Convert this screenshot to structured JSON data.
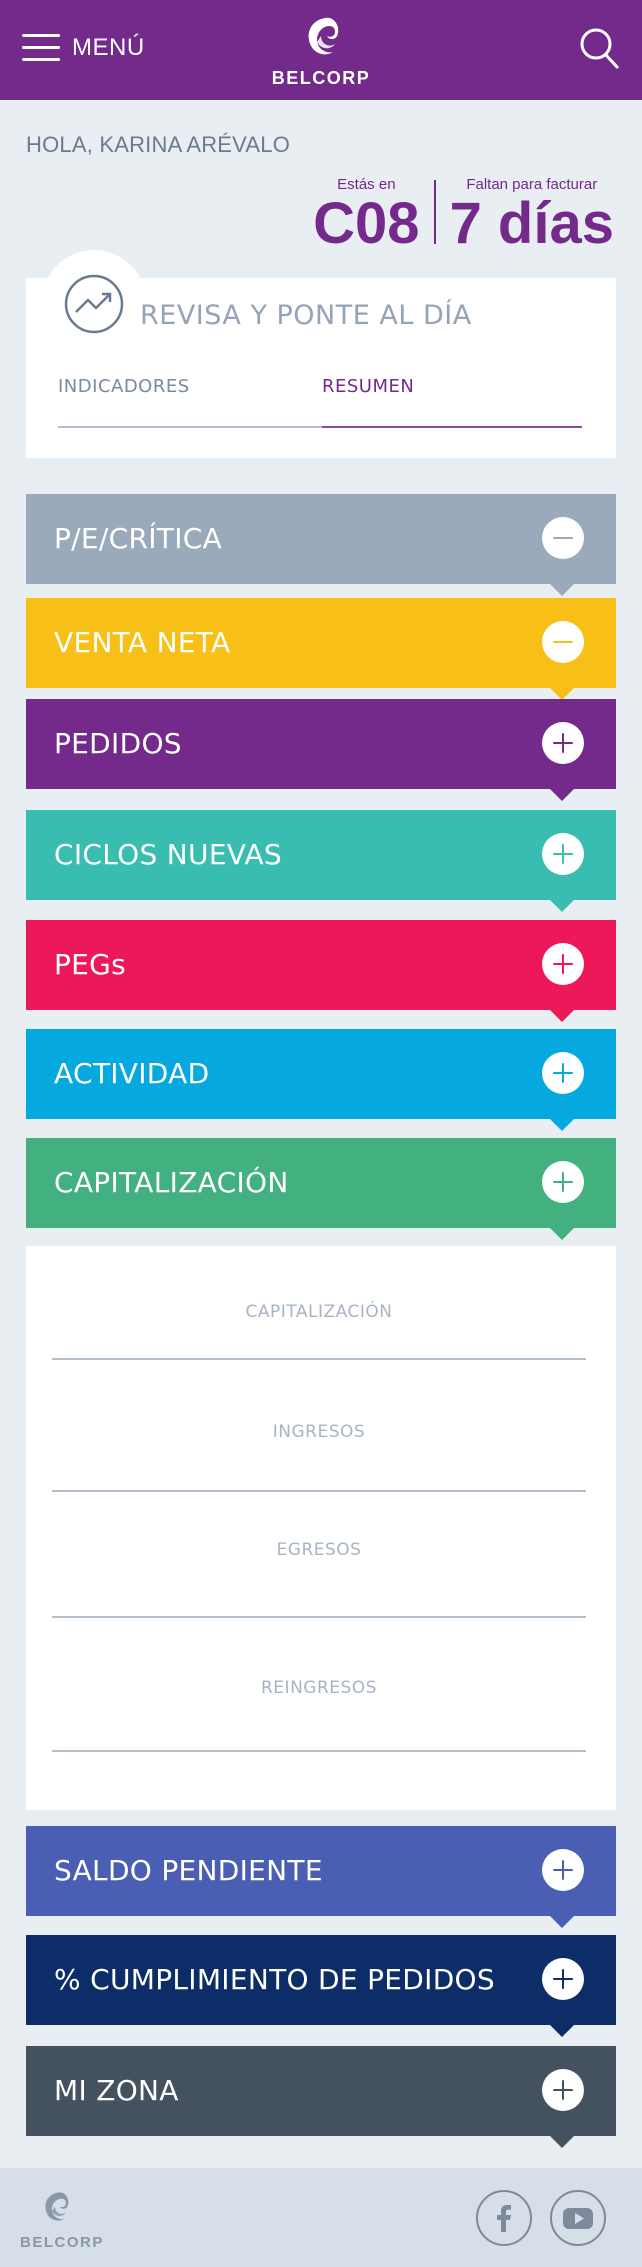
{
  "header": {
    "menu_label": "MENÚ",
    "brand": "BELCORP",
    "background": "#742a8b"
  },
  "greeting": "HOLA, KARINA ARÉVALO",
  "cycle": {
    "current_label": "Estás en",
    "current_value": "C08",
    "remaining_label": "Faltan para facturar",
    "remaining_value": "7 días"
  },
  "card": {
    "title": "REVISA Y PONTE AL DÍA",
    "icon": "trend-chart-icon",
    "tabs": [
      {
        "label": "INDICADORES",
        "active": false
      },
      {
        "label": "RESUMEN",
        "active": true
      }
    ]
  },
  "sections": [
    {
      "label": "P/E/CRÍTICA",
      "color": "#9aaabb",
      "state": "collapse"
    },
    {
      "label": "VENTA NETA",
      "color": "#f8bf17",
      "state": "collapse"
    },
    {
      "label": "PEDIDOS",
      "color": "#742a8b",
      "state": "expand"
    },
    {
      "label": "CICLOS NUEVAS",
      "color": "#3abdb1",
      "state": "expand"
    },
    {
      "label": "PEGs",
      "color": "#ec1859",
      "state": "expand"
    },
    {
      "label": "ACTIVIDAD",
      "color": "#05a9e0",
      "state": "expand"
    },
    {
      "label": "CAPITALIZACIÓN",
      "color": "#42b07f",
      "state": "expand"
    },
    {
      "label": "SALDO PENDIENTE",
      "color": "#4a5fb4",
      "state": "expand"
    },
    {
      "label": "% CUMPLIMIENTO DE PEDIDOS",
      "color": "#0d2d69",
      "state": "expand"
    },
    {
      "label": "MI ZONA",
      "color": "#44515f",
      "state": "expand"
    }
  ],
  "capitalizacion_panel": {
    "metrics": [
      "CAPITALIZACIÓN",
      "INGRESOS",
      "EGRESOS",
      "REINGRESOS"
    ]
  },
  "footer": {
    "brand": "BELCORP",
    "social": [
      "facebook-icon",
      "youtube-icon"
    ]
  }
}
